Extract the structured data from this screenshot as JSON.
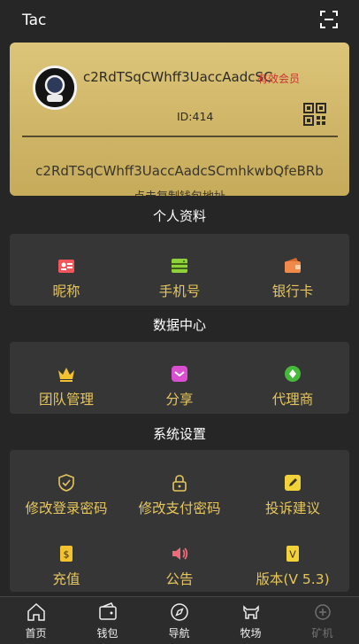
{
  "header": {
    "title": "Tac"
  },
  "card": {
    "username": "c2RdTSqCWhff3UaccAadcSC",
    "member_badge": "有效会员",
    "id_label": "ID:414",
    "address": "c2RdTSqCWhff3UaccAadcSCmhkwbQfeBRb",
    "copy_hint": "点击复制钱包地址"
  },
  "sections": {
    "profile_title": "个人资料",
    "profile_items": [
      "昵称",
      "手机号",
      "银行卡"
    ],
    "data_title": "数据中心",
    "data_items": [
      "团队管理",
      "分享",
      "代理商"
    ],
    "settings_title": "系统设置",
    "settings_items": [
      "修改登录密码",
      "修改支付密码",
      "投诉建议",
      "充值",
      "公告",
      "版本(V 5.3)"
    ]
  },
  "navbar": {
    "items": [
      "首页",
      "钱包",
      "导航",
      "牧场",
      "矿机"
    ]
  },
  "colors": {
    "accent": "#e6c65c",
    "card": "#d6bd6e",
    "background": "#262626",
    "panel": "#363636",
    "badge": "#cc3333"
  }
}
